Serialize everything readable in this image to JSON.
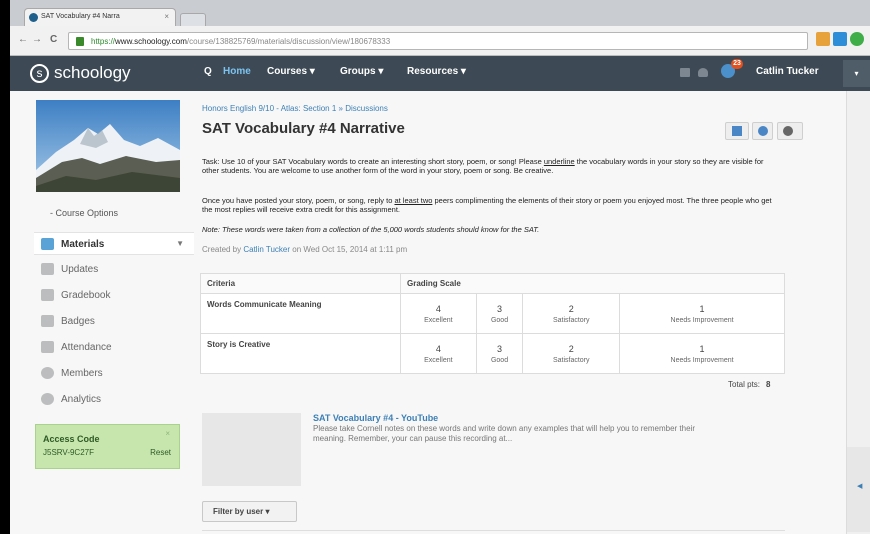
{
  "browser": {
    "tab_title": "SAT Vocabulary #4 Narra",
    "tab_close": "×",
    "url_scheme": "https://",
    "url_host": "www.schoology.com",
    "url_path": "/course/138825769/materials/discussion/view/180678333",
    "back": "←",
    "forward": "→",
    "reload": "C"
  },
  "topbar": {
    "logo": "schoology",
    "logo_letter": "s",
    "search": "Q",
    "home": "Home",
    "courses": "Courses ▾",
    "groups": "Groups ▾",
    "resources": "Resources ▾",
    "notification_count": "23",
    "user": "Catlin Tucker",
    "user_menu": "▾"
  },
  "sidebar": {
    "course_options": "Course Options",
    "items": [
      {
        "label": "Materials",
        "active": true
      },
      {
        "label": "Updates"
      },
      {
        "label": "Gradebook"
      },
      {
        "label": "Badges"
      },
      {
        "label": "Attendance"
      },
      {
        "label": "Members"
      },
      {
        "label": "Analytics"
      }
    ],
    "access_code": {
      "title": "Access Code",
      "code": "J5SRV-9C27F",
      "reset": "Reset",
      "close": "×"
    }
  },
  "main": {
    "breadcrumb": "Honors English 9/10 - Atlas: Section 1 » Discussions",
    "title": "SAT Vocabulary #4 Narrative",
    "task_pre": "Task: Use 10 of your SAT Vocabulary words to create an interesting short story, poem, or song! Please ",
    "task_underline": "underline",
    "task_post": " the vocabulary words in your story so they are visible for other students. You are welcome to use another form of the word in your story, poem or song. Be creative.",
    "reply_pre": "Once you have posted your story, poem, or song, reply to ",
    "reply_underline": "at least two",
    "reply_post": " peers complimenting the elements of their story or poem you enjoyed most. The three people who get the most replies will receive extra credit for this assignment.",
    "note": "Note: These words were taken from a collection of the 5,000 words students should know for the SAT.",
    "created_prefix": "Created by ",
    "created_by": "Catlin Tucker",
    "created_suffix": " on Wed Oct 15, 2014 at 1:11 pm",
    "rubric": {
      "header_criteria": "Criteria",
      "header_scale": "Grading Scale",
      "rows": [
        {
          "criterion": "Words Communicate Meaning",
          "levels": [
            {
              "points": "4",
              "label": "Excellent"
            },
            {
              "points": "3",
              "label": "Good"
            },
            {
              "points": "2",
              "label": "Satisfactory"
            },
            {
              "points": "1",
              "label": "Needs Improvement"
            }
          ]
        },
        {
          "criterion": "Story is Creative",
          "levels": [
            {
              "points": "4",
              "label": "Excellent"
            },
            {
              "points": "3",
              "label": "Good"
            },
            {
              "points": "2",
              "label": "Satisfactory"
            },
            {
              "points": "1",
              "label": "Needs Improvement"
            }
          ]
        }
      ],
      "total_label": "Total pts:",
      "total_value": "8"
    },
    "attachment": {
      "title": "SAT Vocabulary #4 - YouTube",
      "description": "Please take Cornell notes on these words and write down any examples that will help you to remember their meaning. Remember, your can pause this recording at..."
    },
    "filter_button": "Filter by user ▾"
  },
  "colors": {
    "topbar": "#3d4a55",
    "link": "#3d80b6",
    "access_bg": "#c6e6ae",
    "badge": "#e1501f"
  }
}
